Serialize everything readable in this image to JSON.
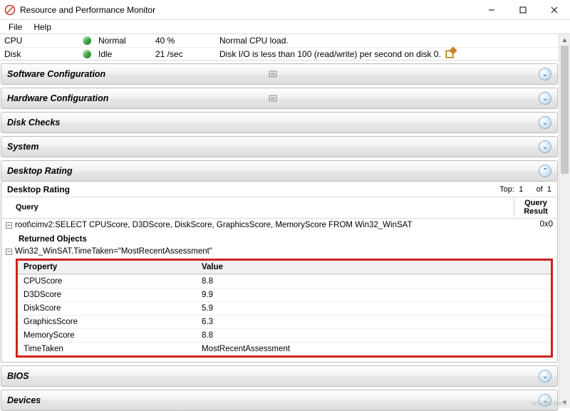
{
  "window": {
    "title": "Resource and Performance Monitor"
  },
  "menu": {
    "file": "File",
    "help": "Help"
  },
  "resources": {
    "rows": [
      {
        "name": "CPU",
        "status": "Normal",
        "value": "40 %",
        "desc": "Normal CPU load.",
        "edit": false
      },
      {
        "name": "Disk",
        "status": "Idle",
        "value": "21 /sec",
        "desc": "Disk I/O is less than 100 (read/write) per second on disk 0.",
        "edit": true
      }
    ]
  },
  "sections": {
    "software": "Software Configuration",
    "hardware": "Hardware Configuration",
    "diskchecks": "Disk Checks",
    "system": "System",
    "desktoprating": "Desktop Rating",
    "bios": "BIOS",
    "devices": "Devices"
  },
  "desktopRating": {
    "title": "Desktop Rating",
    "topLabel": "Top:",
    "topValue": "1",
    "ofLabel": "of",
    "ofValue": "1",
    "queryHeader": "Query",
    "resultHeader": "Query Result",
    "queryText": "root\\cimv2:SELECT CPUScore, D3DScore, DiskScore, GraphicsScore, MemoryScore FROM Win32_WinSAT",
    "queryResult": "0x0",
    "returnedLabel": "Returned Objects",
    "objectLabel": "Win32_WinSAT.TimeTaken=\"MostRecentAssessment\"",
    "propHeader": "Property",
    "valHeader": "Value",
    "props": [
      {
        "p": "CPUScore",
        "v": "8.8"
      },
      {
        "p": "D3DScore",
        "v": "9.9"
      },
      {
        "p": "DiskScore",
        "v": "5.9"
      },
      {
        "p": "GraphicsScore",
        "v": "6.3"
      },
      {
        "p": "MemoryScore",
        "v": "8.8"
      },
      {
        "p": "TimeTaken",
        "v": "MostRecentAssessment"
      }
    ]
  },
  "watermark": "wsxdn.com"
}
